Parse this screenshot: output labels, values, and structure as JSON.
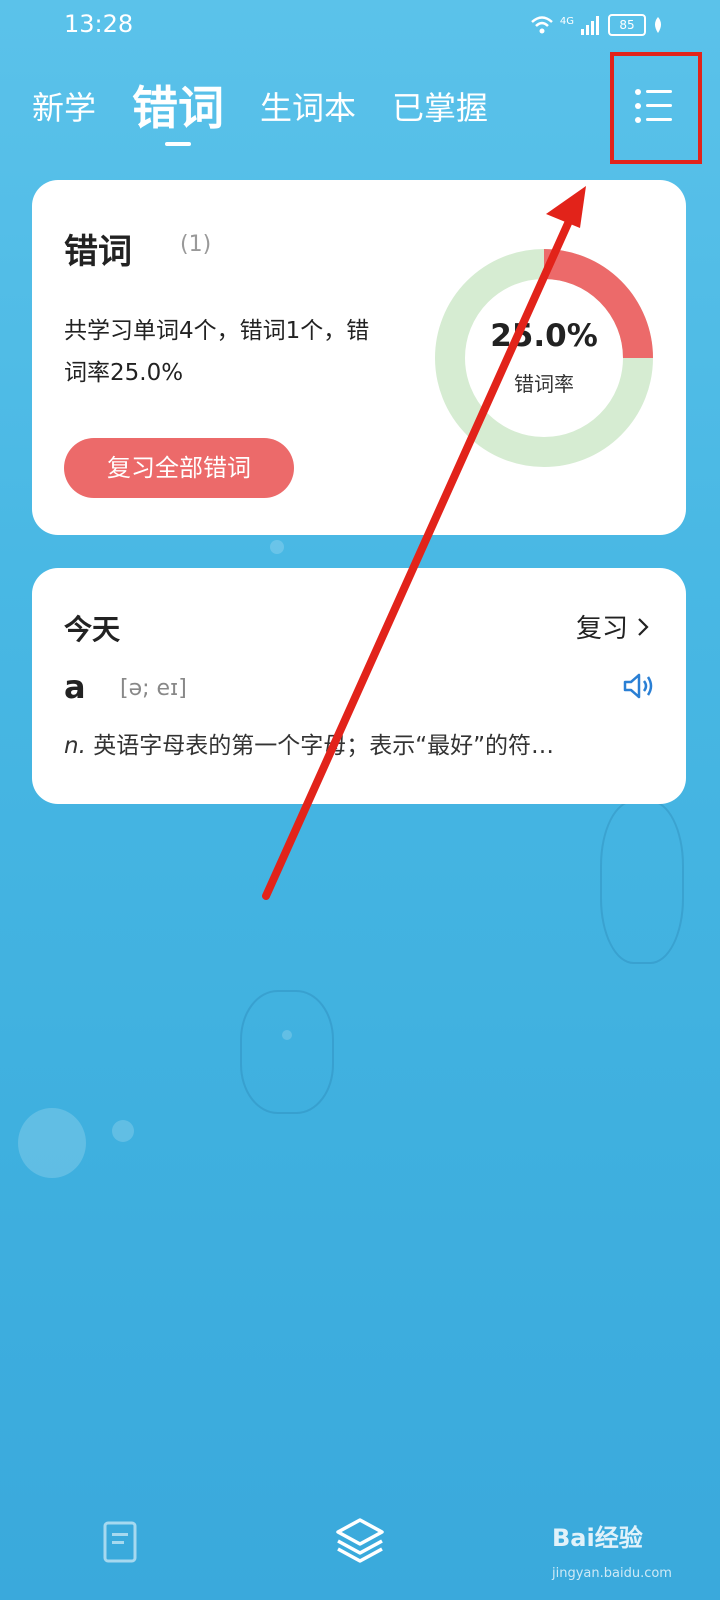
{
  "status_bar": {
    "time": "13:28",
    "network": "4G",
    "battery": "85"
  },
  "tabs": [
    {
      "label": "新学",
      "active": false
    },
    {
      "label": "错词",
      "active": true
    },
    {
      "label": "生词本",
      "active": false
    },
    {
      "label": "已掌握",
      "active": false
    }
  ],
  "wrong_words_card": {
    "title": "错词",
    "count": "(1)",
    "description": "共学习单词4个，错词1个，错词率25.0%",
    "review_button": "复习全部错词",
    "donut": {
      "percent_text": "25.0%",
      "label": "错词率",
      "value": 0.25,
      "color_error": "#ec6a6a",
      "color_rest": "#d6ecd2"
    }
  },
  "today_card": {
    "title": "今天",
    "review_link": "复习",
    "word": "a",
    "phonetic": "[ə; eɪ]",
    "definition_pos": "n.",
    "definition_text": "英语字母表的第一个字母；表示“最好”的符…"
  },
  "watermark": {
    "brand": "Bai经验",
    "url": "jingyan.baidu.com"
  },
  "icons": [
    "menu-icon",
    "speaker-icon",
    "chevron-right-icon",
    "book-icon",
    "layers-icon",
    "wifi-icon",
    "signal-icon",
    "battery-icon"
  ],
  "colors": {
    "annotation_red": "#e2231a",
    "accent_blue": "#2a7fd4"
  }
}
